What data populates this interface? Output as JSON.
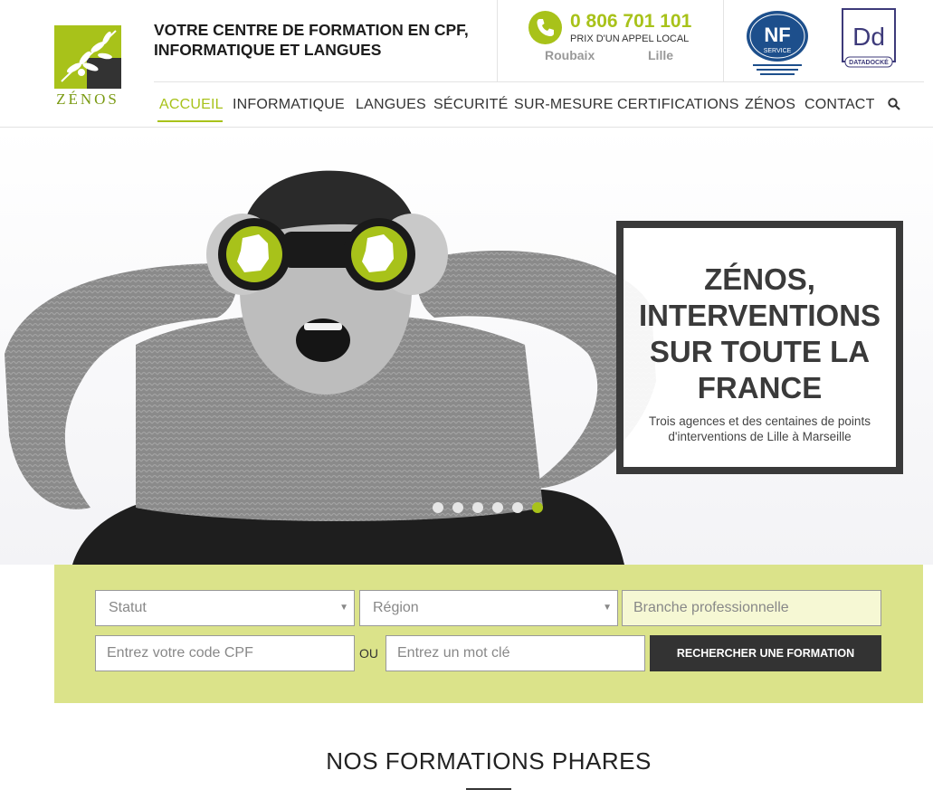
{
  "brand": {
    "name": "ZÉNOS"
  },
  "header": {
    "tagline_line1": "VOTRE CENTRE DE FORMATION EN CPF,",
    "tagline_line2": "INFORMATIQUE ET LANGUES",
    "phone_number": "0 806 701 101",
    "phone_caption": "PRIX D'UN APPEL LOCAL",
    "cities": [
      "Roubaix",
      "Lille"
    ],
    "badges": {
      "nf_label": "NF",
      "nf_sub": "SERVICE",
      "dd_label": "Dd",
      "dd_sub": "DATADOCKÉ"
    }
  },
  "nav": {
    "items": [
      "ACCUEIL",
      "INFORMATIQUE",
      "LANGUES",
      "SÉCURITÉ",
      "SUR-MESURE",
      "CERTIFICATIONS",
      "ZÉNOS",
      "CONTACT"
    ],
    "active": "ACCUEIL",
    "search_icon": "search-icon"
  },
  "hero": {
    "title": "ZÉNOS, INTERVENTIONS SUR TOUTE LA FRANCE",
    "subtitle": "Trois agences et des centaines de points d'interventions de Lille à Marseille",
    "slide_count": 6,
    "active_slide": 6
  },
  "search": {
    "statut_placeholder": "Statut",
    "region_placeholder": "Région",
    "branche_placeholder": "Branche professionnelle",
    "cpf_placeholder": "Entrez votre code CPF",
    "or_label": "OU",
    "keyword_placeholder": "Entrez un mot clé",
    "submit_label": "RECHERCHER UNE FORMATION"
  },
  "section": {
    "title": "NOS FORMATIONS PHARES"
  },
  "colors": {
    "accent": "#a8c21a",
    "dark": "#333333",
    "search_bg": "#dbe38a"
  }
}
